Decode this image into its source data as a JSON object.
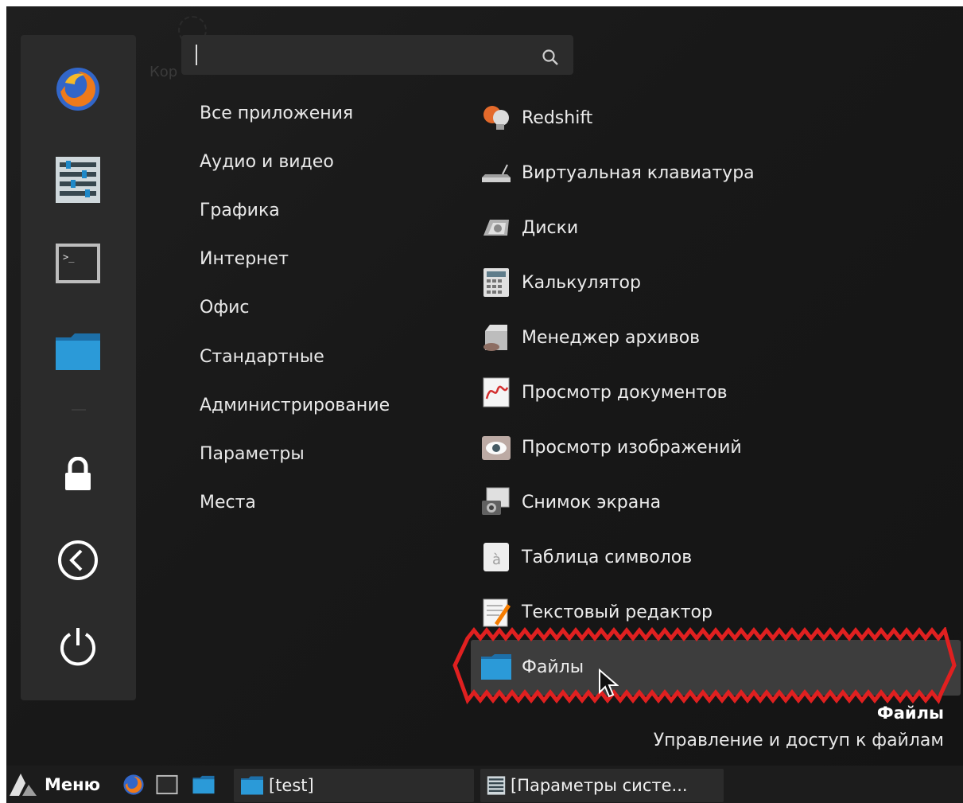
{
  "desktop": {
    "icon_label": "Кор"
  },
  "search": {
    "placeholder": "",
    "value": ""
  },
  "favorites": [
    {
      "icon": "firefox-icon"
    },
    {
      "icon": "system-settings-icon"
    },
    {
      "icon": "terminal-icon"
    },
    {
      "icon": "folder-icon"
    },
    {
      "icon": "lock-icon"
    },
    {
      "icon": "logout-icon"
    },
    {
      "icon": "power-icon"
    }
  ],
  "categories": [
    "Все приложения",
    "Аудио и видео",
    "Графика",
    "Интернет",
    "Офис",
    "Стандартные",
    "Администрирование",
    "Параметры",
    "Места"
  ],
  "apps": [
    {
      "label": "Redshift",
      "icon": "redshift-icon"
    },
    {
      "label": "Виртуальная клавиатура",
      "icon": "keyboard-icon"
    },
    {
      "label": "Диски",
      "icon": "disks-icon"
    },
    {
      "label": "Калькулятор",
      "icon": "calculator-icon"
    },
    {
      "label": "Менеджер архивов",
      "icon": "archive-manager-icon"
    },
    {
      "label": "Просмотр документов",
      "icon": "document-viewer-icon"
    },
    {
      "label": "Просмотр изображений",
      "icon": "image-viewer-icon"
    },
    {
      "label": "Снимок экрана",
      "icon": "screenshot-icon"
    },
    {
      "label": "Таблица символов",
      "icon": "character-map-icon"
    },
    {
      "label": "Текстовый редактор",
      "icon": "text-editor-icon"
    },
    {
      "label": "Файлы",
      "icon": "folder-icon"
    }
  ],
  "description": {
    "title": "Файлы",
    "text": "Управление и доступ к файлам"
  },
  "taskbar": {
    "menu_label": "Меню",
    "tasks": [
      {
        "label": "[test]",
        "icon": "folder-icon"
      },
      {
        "label": "[Параметры систе...",
        "icon": "system-settings-icon"
      }
    ]
  },
  "colors": {
    "highlight_outline": "#e02020",
    "panel": "#2b2b2b",
    "background": "#181818"
  }
}
